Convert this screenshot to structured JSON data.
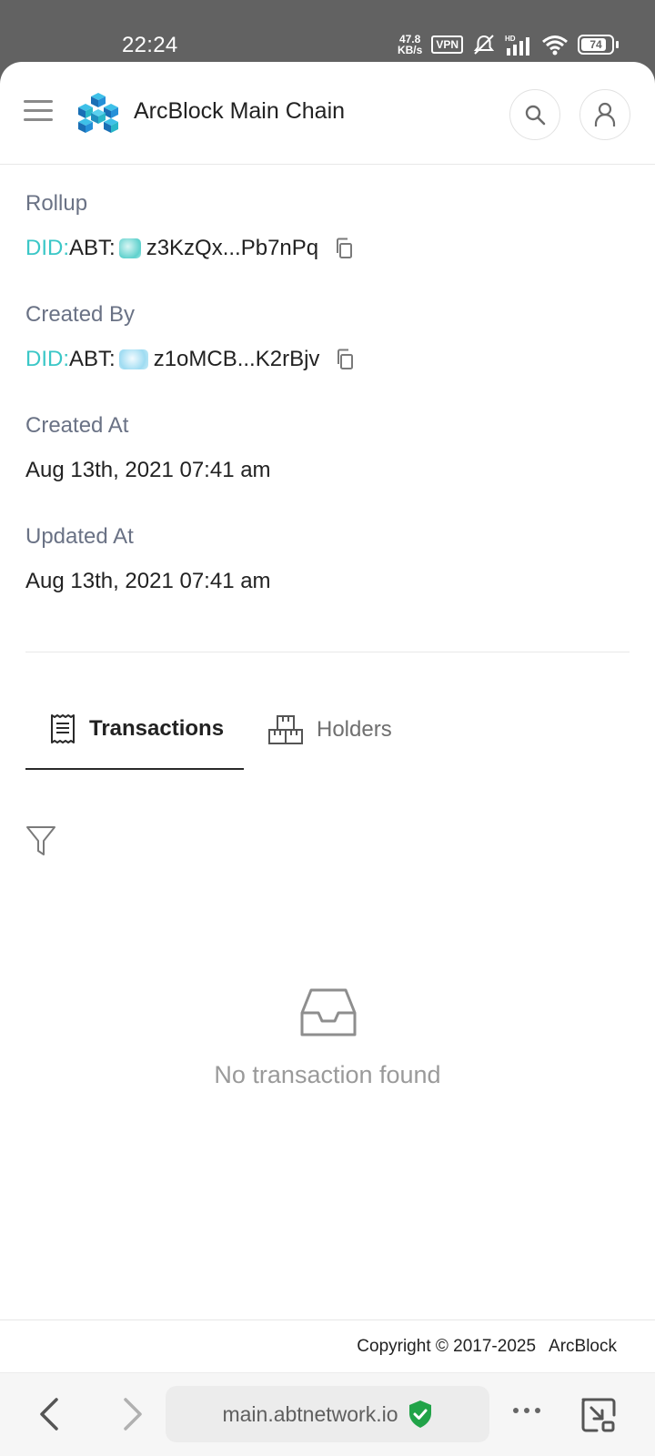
{
  "status_bar": {
    "time": "22:24",
    "net_speed_value": "47.8",
    "net_speed_unit": "KB/s",
    "vpn": "VPN",
    "battery": "74"
  },
  "header": {
    "title": "ArcBlock Main Chain"
  },
  "details": {
    "rollup_label": "Rollup",
    "rollup_prefix": "DID:",
    "rollup_chain": "ABT:",
    "rollup_address": "z3KzQx...Pb7nPq",
    "created_by_label": "Created By",
    "created_by_prefix": "DID:",
    "created_by_chain": "ABT:",
    "created_by_address": "z1oMCB...K2rBjv",
    "created_at_label": "Created At",
    "created_at_value": "Aug 13th, 2021 07:41 am",
    "updated_at_label": "Updated At",
    "updated_at_value": "Aug 13th, 2021 07:41 am"
  },
  "tabs": [
    {
      "label": "Transactions",
      "active": true
    },
    {
      "label": "Holders",
      "active": false
    }
  ],
  "empty_state": {
    "message": "No transaction found"
  },
  "footer": {
    "copyright": "Copyright © 2017-2025",
    "brand": "ArcBlock"
  },
  "browser": {
    "url": "main.abtnetwork.io"
  },
  "colors": {
    "did_prefix": "#3bc7c7",
    "label": "#6a7285",
    "secure_badge": "#21a348"
  }
}
